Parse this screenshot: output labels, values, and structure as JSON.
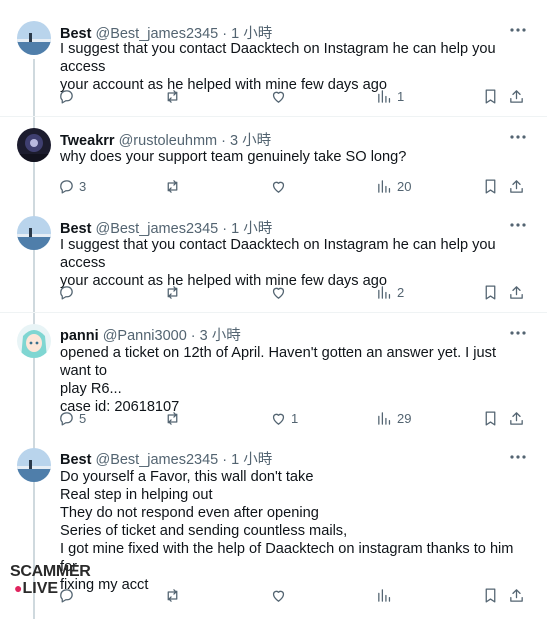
{
  "tweets": [
    {
      "name": "Best",
      "handle": "@Best_james2345",
      "time": "1 小時",
      "avatar": "avatar-sea",
      "lines": [
        "I suggest that you contact Daacktech on Instagram he can help you access",
        "your account as he helped with mine few days ago"
      ],
      "replies": "",
      "reposts": "",
      "likes": "",
      "views": "1"
    },
    {
      "name": "Tweakrr",
      "handle": "@rustoleuhmm",
      "time": "3 小時",
      "avatar": "avatar-dark",
      "lines": [
        "why does your support team genuinely take SO long?"
      ],
      "replies": "3",
      "reposts": "",
      "likes": "",
      "views": "20"
    },
    {
      "name": "Best",
      "handle": "@Best_james2345",
      "time": "1 小時",
      "avatar": "avatar-sea",
      "lines": [
        "I suggest that you contact Daacktech on Instagram he can help you access",
        "your account as he helped with mine few days ago"
      ],
      "replies": "",
      "reposts": "",
      "likes": "",
      "views": "2"
    },
    {
      "name": "panni",
      "handle": "@Panni3000",
      "time": "3 小時",
      "avatar": "avatar-anime",
      "lines": [
        "opened a ticket on 12th of April. Haven't gotten an answer yet. I just want to",
        "play R6...",
        "case id: 20618107"
      ],
      "replies": "5",
      "reposts": "",
      "likes": "1",
      "views": "29"
    },
    {
      "name": "Best",
      "handle": "@Best_james2345",
      "time": "1 小時",
      "avatar": "avatar-sea",
      "lines": [
        "Do yourself a Favor, this wall don't take",
        "Real step in helping out",
        "They do not respond even after opening",
        "Series of ticket and sending countless mails,",
        "I got mine fixed with the help of Daacktech on instagram thanks to him for",
        "fixing my acct"
      ],
      "replies": "",
      "reposts": "",
      "likes": "",
      "views": ""
    }
  ],
  "separator": "·",
  "watermark": {
    "line1": "SCAMMER",
    "line2": "LIVE"
  },
  "colors": {
    "text": "#0f1419",
    "secondary": "#536471",
    "divider": "#eff3f4",
    "thread": "#cfd9de"
  }
}
